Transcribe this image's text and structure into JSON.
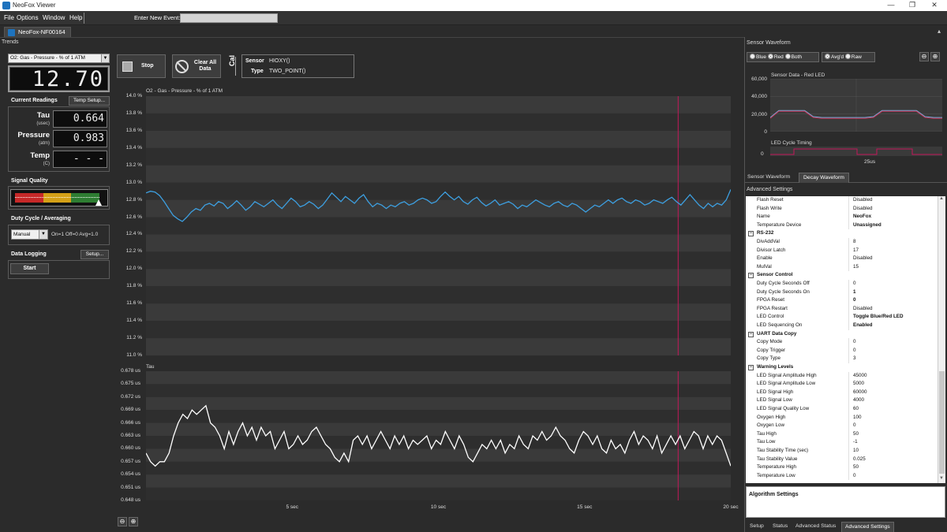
{
  "window": {
    "title": "NeoFox Viewer",
    "minimize": "—",
    "maximize": "❐",
    "close": "✕"
  },
  "menu": [
    "File",
    "Options",
    "Window",
    "Help"
  ],
  "event": {
    "label": "Enter New Event:",
    "value": ""
  },
  "doc_tab": "NeoFox-NF00164",
  "trends_label": "Trends",
  "left": {
    "param_select": "O2: Gas - Pressure - % of 1 ATM",
    "main_value": "12.70",
    "current_readings": "Current Readings",
    "temp_setup": "Temp Setup...",
    "readings": [
      {
        "label": "Tau",
        "unit": "(usec)",
        "value": "0.664"
      },
      {
        "label": "Pressure",
        "unit": "(atm)",
        "value": "0.983"
      },
      {
        "label": "Temp",
        "unit": "(C)",
        "value": "- - -"
      }
    ],
    "signal_quality": "Signal Quality",
    "duty_cycle": "Duty Cycle / Averaging",
    "duty_select": "Manual",
    "duty_text": "On=1 Off=0 Avg=1.0",
    "data_logging": "Data Logging",
    "setup": "Setup...",
    "start": "Start"
  },
  "toolbar": {
    "stop": "Stop",
    "clear_line1": "Clear All",
    "clear_line2": "Data",
    "cal": "Cal",
    "sensor_label": "Sensor",
    "sensor_value": "HIOXY()",
    "type_label": "Type",
    "type_value": "TWO_POINT()"
  },
  "chart_data": [
    {
      "type": "line",
      "title": "O2 - Gas - Pressure - % of 1 ATM",
      "y_ticks": [
        "14.0 %",
        "13.8 %",
        "13.6 %",
        "13.4 %",
        "13.2 %",
        "13.0 %",
        "12.8 %",
        "12.6 %",
        "12.4 %",
        "12.2 %",
        "12.0 %",
        "11.8 %",
        "11.6 %",
        "11.4 %",
        "11.2 %",
        "11.0 %"
      ],
      "ylim": [
        11.0,
        14.0
      ],
      "xlim": [
        0,
        20
      ],
      "color": "#3d9fe0",
      "y": [
        12.88,
        12.9,
        12.89,
        12.85,
        12.78,
        12.7,
        12.62,
        12.58,
        12.55,
        12.6,
        12.66,
        12.7,
        12.68,
        12.74,
        12.76,
        12.73,
        12.78,
        12.76,
        12.7,
        12.74,
        12.79,
        12.74,
        12.68,
        12.72,
        12.78,
        12.75,
        12.72,
        12.76,
        12.8,
        12.74,
        12.7,
        12.76,
        12.82,
        12.78,
        12.72,
        12.74,
        12.78,
        12.75,
        12.7,
        12.74,
        12.81,
        12.88,
        12.83,
        12.78,
        12.84,
        12.8,
        12.76,
        12.82,
        12.86,
        12.78,
        12.72,
        12.76,
        12.74,
        12.7,
        12.74,
        12.72,
        12.76,
        12.78,
        12.74,
        12.76,
        12.8,
        12.82,
        12.8,
        12.76,
        12.78,
        12.84,
        12.89,
        12.84,
        12.8,
        12.84,
        12.78,
        12.75,
        12.8,
        12.83,
        12.77,
        12.73,
        12.76,
        12.8,
        12.74,
        12.76,
        12.78,
        12.75,
        12.7,
        12.74,
        12.72,
        12.76,
        12.8,
        12.77,
        12.74,
        12.72,
        12.76,
        12.78,
        12.74,
        12.72,
        12.76,
        12.74,
        12.7,
        12.66,
        12.7,
        12.74,
        12.72,
        12.76,
        12.8,
        12.76,
        12.8,
        12.82,
        12.78,
        12.76,
        12.8,
        12.78,
        12.74,
        12.76,
        12.8,
        12.78,
        12.76,
        12.8,
        12.83,
        12.78,
        12.74,
        12.8,
        12.86,
        12.8,
        12.74,
        12.7,
        12.76,
        12.72,
        12.76,
        12.74,
        12.8,
        12.92
      ],
      "x_ticks": [
        {
          "x": 5,
          "label": "5 sec"
        },
        {
          "x": 10,
          "label": "10 sec"
        },
        {
          "x": 15,
          "label": "15 sec"
        },
        {
          "x": 20,
          "label": "20 sec"
        }
      ],
      "marker_x": 18.2
    },
    {
      "type": "line",
      "title": "Tau",
      "y_ticks": [
        "0.678 us",
        "0.675 us",
        "0.672 us",
        "0.669 us",
        "0.666 us",
        "0.663 us",
        "0.660 us",
        "0.657 us",
        "0.654 us",
        "0.651 us",
        "0.648 us"
      ],
      "ylim": [
        0.648,
        0.678
      ],
      "xlim": [
        0,
        20
      ],
      "color": "#ffffff",
      "y": [
        0.659,
        0.657,
        0.656,
        0.657,
        0.657,
        0.659,
        0.663,
        0.666,
        0.668,
        0.667,
        0.669,
        0.668,
        0.669,
        0.67,
        0.666,
        0.665,
        0.663,
        0.66,
        0.664,
        0.661,
        0.664,
        0.666,
        0.663,
        0.665,
        0.662,
        0.665,
        0.663,
        0.664,
        0.66,
        0.662,
        0.664,
        0.66,
        0.661,
        0.663,
        0.661,
        0.662,
        0.664,
        0.665,
        0.663,
        0.661,
        0.66,
        0.658,
        0.657,
        0.659,
        0.657,
        0.662,
        0.663,
        0.661,
        0.663,
        0.66,
        0.662,
        0.664,
        0.662,
        0.66,
        0.663,
        0.661,
        0.663,
        0.66,
        0.662,
        0.661,
        0.662,
        0.663,
        0.66,
        0.662,
        0.661,
        0.664,
        0.662,
        0.66,
        0.663,
        0.661,
        0.658,
        0.657,
        0.659,
        0.661,
        0.66,
        0.662,
        0.66,
        0.662,
        0.659,
        0.661,
        0.66,
        0.663,
        0.661,
        0.66,
        0.663,
        0.662,
        0.664,
        0.662,
        0.663,
        0.665,
        0.663,
        0.662,
        0.66,
        0.659,
        0.662,
        0.664,
        0.663,
        0.661,
        0.663,
        0.66,
        0.659,
        0.662,
        0.66,
        0.661,
        0.659,
        0.662,
        0.664,
        0.661,
        0.663,
        0.662,
        0.66,
        0.663,
        0.659,
        0.661,
        0.663,
        0.661,
        0.663,
        0.66,
        0.662,
        0.664,
        0.663,
        0.66,
        0.663,
        0.661,
        0.663,
        0.662,
        0.659,
        0.656
      ],
      "marker_x": 18.2
    },
    {
      "type": "line",
      "title": "Sensor Data - Red LED",
      "y_ticks": [
        "60,000",
        "40,000",
        "20,000",
        "0"
      ],
      "ylim": [
        0,
        60000
      ],
      "series": [
        {
          "color": "#7fb3e6",
          "y": [
            16000,
            24000,
            24000,
            24000,
            24000,
            17000,
            16000,
            16000,
            16000,
            16000,
            16000,
            16000,
            17000,
            24000,
            24000,
            24000,
            24000,
            24000,
            17000,
            16000,
            16000
          ]
        },
        {
          "color": "#c03050",
          "y": [
            15000,
            23000,
            23000,
            23000,
            23000,
            16000,
            15000,
            15000,
            15000,
            15000,
            15000,
            15000,
            16000,
            23000,
            23000,
            23000,
            23000,
            23000,
            16000,
            15000,
            15000
          ]
        }
      ]
    }
  ],
  "right": {
    "title": "Sensor Waveform",
    "radios": [
      "Blue",
      "Red",
      "Both"
    ],
    "radios2": [
      "Avg'd",
      "Raw"
    ],
    "led_timing": "LED Cycle Timing",
    "led_zero": "0",
    "led_tick": "25us",
    "tabs": [
      "Sensor Waveform",
      "Decay Waveform"
    ],
    "adv_title": "Advanced Settings",
    "props": [
      {
        "k": "Flash Reset",
        "v": "Disabled"
      },
      {
        "k": "Flash Write",
        "v": "Disabled"
      },
      {
        "k": "Name",
        "v": "NeoFox",
        "b": true
      },
      {
        "k": "Temperature Device",
        "v": "Unassigned",
        "b": true
      },
      {
        "cat": "RS-232"
      },
      {
        "k": "DivAddVal",
        "v": "8"
      },
      {
        "k": "Divisor Latch",
        "v": "17"
      },
      {
        "k": "Enable",
        "v": "Disabled"
      },
      {
        "k": "MulVal",
        "v": "15"
      },
      {
        "cat": "Sensor Control"
      },
      {
        "k": "Duty Cycle Seconds Off",
        "v": "0"
      },
      {
        "k": "Duty Cycle Seconds On",
        "v": "1",
        "b": true
      },
      {
        "k": "FPGA Reset",
        "v": "0",
        "b": true
      },
      {
        "k": "FPGA Restart",
        "v": "Disabled"
      },
      {
        "k": "LED Control",
        "v": "Toggle Blue/Red LED",
        "b": true
      },
      {
        "k": "LED Sequencing On",
        "v": "Enabled",
        "b": true
      },
      {
        "cat": "UART Data Copy"
      },
      {
        "k": "Copy Mode",
        "v": "0"
      },
      {
        "k": "Copy Trigger",
        "v": "0"
      },
      {
        "k": "Copy Type",
        "v": "3"
      },
      {
        "cat": "Warning Levels"
      },
      {
        "k": "LED Signal Amplitude High",
        "v": "45000"
      },
      {
        "k": "LED Signal Amplitude Low",
        "v": "5000"
      },
      {
        "k": "LED Signal High",
        "v": "60000"
      },
      {
        "k": "LED Signal Low",
        "v": "4000"
      },
      {
        "k": "LED Signal Quality Low",
        "v": "60"
      },
      {
        "k": "Oxygen High",
        "v": "100"
      },
      {
        "k": "Oxygen Low",
        "v": "0"
      },
      {
        "k": "Tau High",
        "v": "50"
      },
      {
        "k": "Tau Low",
        "v": "-1"
      },
      {
        "k": "Tau Stability Time (sec)",
        "v": "10"
      },
      {
        "k": "Tau Stability Value",
        "v": "0.025"
      },
      {
        "k": "Temperature High",
        "v": "50"
      },
      {
        "k": "Temperature Low",
        "v": "0"
      }
    ],
    "algo": "Algorithm Settings",
    "bottom_tabs": [
      "Setup",
      "Status",
      "Advanced Status",
      "Advanced Settings"
    ]
  },
  "colors": {
    "marker": "#c2185b",
    "plot_bg_a": "#3a3a3a",
    "plot_bg_b": "#2e2e2e"
  }
}
